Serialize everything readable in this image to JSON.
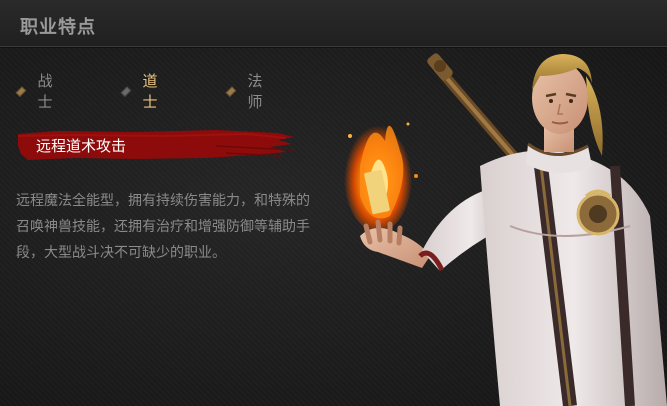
{
  "header": {
    "title": "职业特点"
  },
  "tabs": [
    {
      "label": "战士"
    },
    {
      "label": "道士"
    },
    {
      "label": "法师"
    }
  ],
  "feature": {
    "label": "远程道术攻击",
    "description": "远程魔法全能型，拥有持续伤害能力，和特殊的召唤神兽技能，还拥有治疗和增强防御等辅助手段，大型战斗决不可缺少的职业。"
  },
  "colors": {
    "accent_active": "#e8c37e",
    "brush_red": "#8e0b0b",
    "tab_marker": "#9c7b4a"
  },
  "illustration": {
    "subject": "taoist-character-illustration"
  }
}
